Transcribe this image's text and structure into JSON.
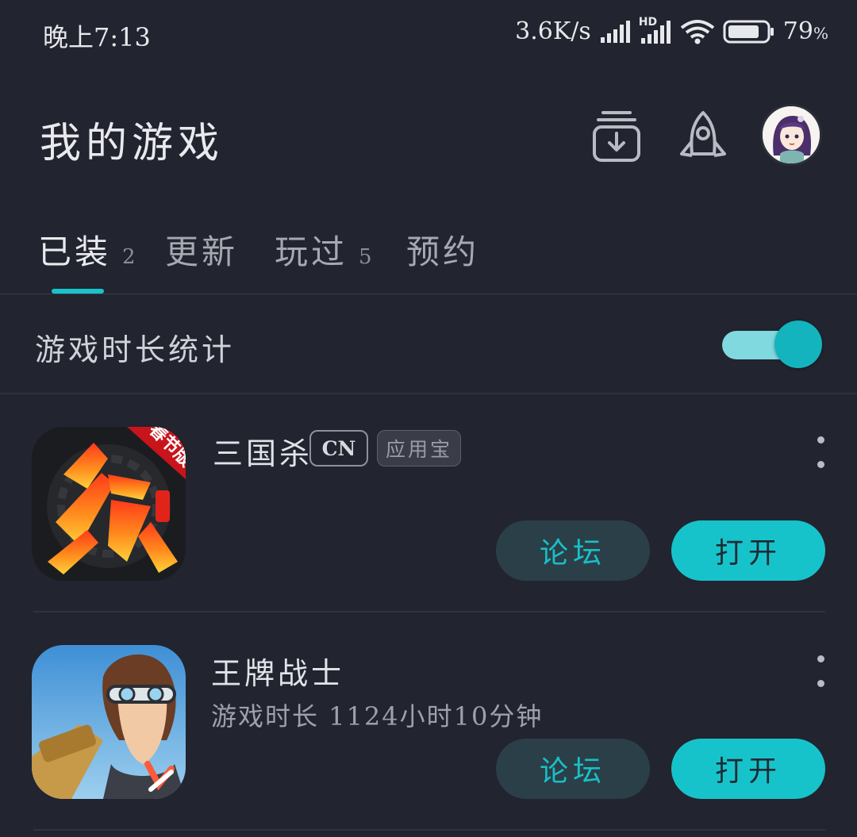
{
  "status_bar": {
    "time": "晚上7:13",
    "net_speed": "3.6K/s",
    "hd_label": "HD",
    "battery": "79",
    "battery_unit": "%",
    "icons": [
      "signal-icon",
      "hd-signal-icon",
      "wifi-icon",
      "battery-icon"
    ]
  },
  "header": {
    "title": "我的游戏",
    "icons": [
      "download-manager-icon",
      "rocket-icon",
      "avatar"
    ]
  },
  "tabs": [
    {
      "label": "已装",
      "count": "2",
      "active": true
    },
    {
      "label": "更新",
      "count": "",
      "active": false
    },
    {
      "label": "玩过",
      "count": "5",
      "active": false
    },
    {
      "label": "预约",
      "count": "",
      "active": false
    }
  ],
  "stats": {
    "label": "游戏时长统计",
    "enabled": true
  },
  "games": [
    {
      "name": "三国杀",
      "badges": [
        "CN",
        "应用宝"
      ],
      "icon_text": "杀",
      "icon_banner": "春节版",
      "playtime": "",
      "forum_label": "论坛",
      "open_label": "打开"
    },
    {
      "name": "王牌战士",
      "badges": [],
      "playtime": "游戏时长 1124小时10分钟",
      "forum_label": "论坛",
      "open_label": "打开"
    }
  ],
  "colors": {
    "background": "#22242f",
    "accent": "#17c3cb",
    "forum_button_bg": "#2b3f48"
  }
}
